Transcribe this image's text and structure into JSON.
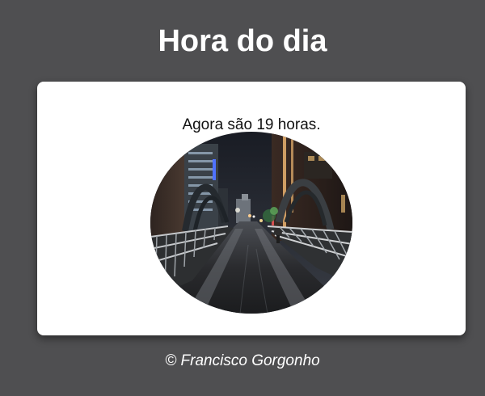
{
  "header": {
    "title": "Hora do dia"
  },
  "card": {
    "message": "Agora são 19 horas.",
    "image": {
      "alt": "Ponte iluminada à noite",
      "icon": "night-bridge-photo"
    }
  },
  "footer": {
    "text": "© Francisco Gorgonho"
  },
  "colors": {
    "background": "#4f4f51",
    "card": "#ffffff",
    "title_text": "#ffffff"
  }
}
